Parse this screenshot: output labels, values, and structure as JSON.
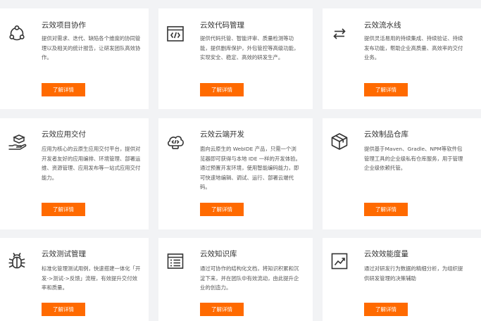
{
  "cards": [
    {
      "title": "云效项目协作",
      "icon": "project-collaboration-icon",
      "description": "提供对需求、迭代、缺陷各个维度的协同管理以及相关的统计报告，让研发团队高效协作。",
      "button_label": "了解详情"
    },
    {
      "title": "云效代码管理",
      "icon": "code-management-icon",
      "description": "提供代码托管、智能评审、质量检测等功能，提供删库保护，外包管控等高级功能，实现安全、稳定、高效的研发生产。",
      "button_label": "了解详情"
    },
    {
      "title": "云效流水线",
      "icon": "pipeline-icon",
      "description": "提供灵活易用的持续集成、持续验证、持续发布功能，帮助企业高质量、高效率的交付业务。",
      "button_label": "了解详情"
    },
    {
      "title": "云效应用交付",
      "icon": "app-delivery-icon",
      "description": "应用为核心的云原生应用交付平台，提供对开发者友好的应用编排、环境管理、部署运维、资源管理、应用发布等一站式应用交付能力。",
      "button_label": "了解详情"
    },
    {
      "title": "云效云端开发",
      "icon": "cloud-development-icon",
      "description": "面向云原生的 WebIDE 产品，只需一个浏览器即可获得与本地 IDE 一样的开发体验。通过预置开发环境，使用智能编码能力，即可快速地编辑、调试、运行、部署云端代码。",
      "button_label": "了解详情"
    },
    {
      "title": "云效制品仓库",
      "icon": "artifact-repository-icon",
      "description": "提供基于Maven、Gradle、NPM等软件包管理工具的企业级私有仓库服务，用于管理企业级依赖托管。",
      "button_label": "了解详情"
    },
    {
      "title": "云效测试管理",
      "icon": "test-management-icon",
      "description": "标准化管理测试用例，快速搭建一体化「开发->测试->反馈」流程，有效提升交付效率和质量。",
      "button_label": "了解详情"
    },
    {
      "title": "云效知识库",
      "icon": "knowledge-base-icon",
      "description": "通过可协作的结构化文档，将知识积累和沉淀下来，并在团队中有效流动，由此提升企业的创造力。",
      "button_label": "了解详情"
    },
    {
      "title": "云效效能度量",
      "icon": "performance-metrics-icon",
      "description": "通过对研发行为数据的精细分析，为组织提供研发管理的决策辅助",
      "button_label": "了解详情"
    }
  ]
}
